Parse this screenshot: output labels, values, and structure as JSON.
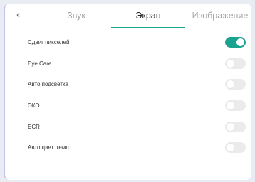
{
  "tabs": {
    "back_icon": "chevron-left-icon",
    "back_glyph": "‹",
    "items": [
      {
        "label": "Звук",
        "active": false
      },
      {
        "label": "Экран",
        "active": true
      },
      {
        "label": "Изображение",
        "active": false
      }
    ]
  },
  "settings": [
    {
      "label": "Сдвиг пикселей",
      "on": true
    },
    {
      "label": "Eye Care",
      "on": false
    },
    {
      "label": "Авто подсветка",
      "on": false
    },
    {
      "label": "ЭКО",
      "on": false
    },
    {
      "label": "ECR",
      "on": false
    },
    {
      "label": "Авто цвет. темп",
      "on": false
    }
  ],
  "colors": {
    "accent": "#1ba392",
    "toggle_off": "#ebebeb",
    "panel_border": "#c9c3ec"
  }
}
